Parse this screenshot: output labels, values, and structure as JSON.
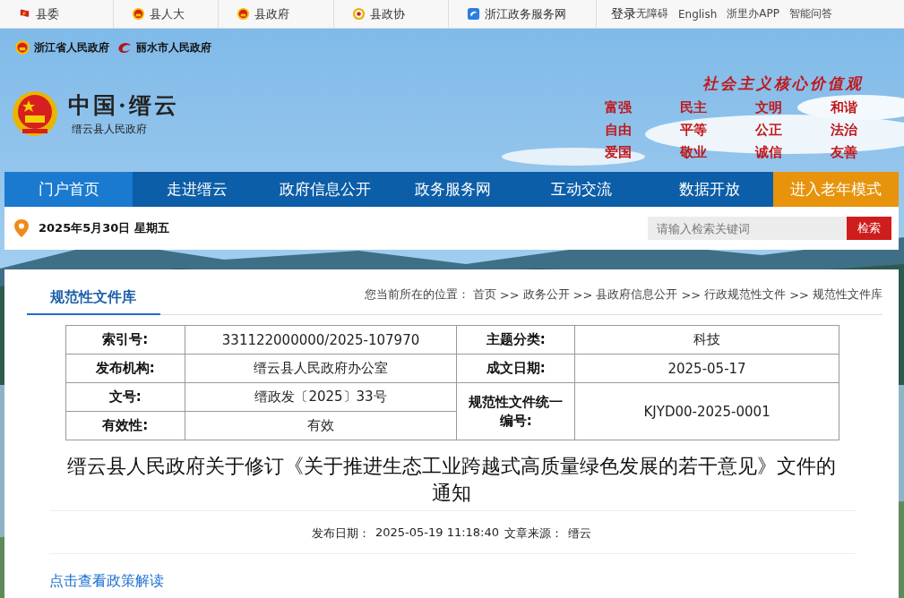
{
  "top_bar": {
    "links": [
      {
        "label": "县委",
        "kind": "party"
      },
      {
        "label": "县人大",
        "kind": "emblem"
      },
      {
        "label": "县政府",
        "kind": "emblem"
      },
      {
        "label": "县政协",
        "kind": "cppcc"
      },
      {
        "label": "浙江政务服务网",
        "kind": "service"
      }
    ],
    "login": "登录",
    "right_links": [
      "无障碍",
      "English",
      "浙里办APP",
      "智能问答"
    ]
  },
  "banner": {
    "parent_sites": [
      {
        "label": "浙江省人民政府",
        "kind": "emblem"
      },
      {
        "label": "丽水市人民政府",
        "kind": "city"
      }
    ],
    "site_title": "中国·缙云",
    "site_subtitle": "缙云县人民政府",
    "values_title": "社会主义核心价值观",
    "values": [
      "富强",
      "民主",
      "文明",
      "和谐",
      "自由",
      "平等",
      "公正",
      "法治",
      "爱国",
      "敬业",
      "诚信",
      "友善"
    ]
  },
  "nav": [
    {
      "label": "门户首页",
      "kind": "normal",
      "selected": true
    },
    {
      "label": "走进缙云",
      "kind": "normal",
      "selected": false
    },
    {
      "label": "政府信息公开",
      "kind": "normal",
      "selected": false
    },
    {
      "label": "政务服务网",
      "kind": "normal",
      "selected": false
    },
    {
      "label": "互动交流",
      "kind": "normal",
      "selected": false
    },
    {
      "label": "数据开放",
      "kind": "normal",
      "selected": false
    },
    {
      "label": "进入老年模式",
      "kind": "elder",
      "selected": false
    }
  ],
  "date_bar": {
    "date": "2025年5月30日 星期五",
    "search": {
      "placeholder": "请输入检索关键词",
      "button": "检索"
    }
  },
  "content": {
    "section_tab": "规范性文件库",
    "breadcrumb": {
      "prefix": "您当前所在的位置：",
      "items": [
        {
          "label": "首页",
          "separator": ">>"
        },
        {
          "label": "政务公开",
          "separator": ">>"
        },
        {
          "label": "县政府信息公开",
          "separator": ">>"
        },
        {
          "label": "行政规范性文件",
          "separator": ">>"
        },
        {
          "label": "规范性文件库"
        }
      ]
    },
    "info_table": {
      "left": [
        {
          "label": "索引号:",
          "value": "331122000000/2025-107970"
        },
        {
          "label": "发布机构:",
          "value": "缙云县人民政府办公室"
        },
        {
          "label": "文号:",
          "value": "缙政发〔2025〕33号"
        },
        {
          "label": "有效性:",
          "value": "有效"
        }
      ],
      "right": [
        {
          "label": "主题分类:",
          "value": "科技"
        },
        {
          "label": "成文日期:",
          "value": "2025-05-17"
        },
        {
          "label": "规范性文件统一编号:",
          "value": "KJYD00-2025-0001"
        }
      ]
    },
    "title": "缙云县人民政府关于修订《关于推进生态工业跨越式高质量绿色发展的若干意见》文件的通知",
    "meta": [
      {
        "label": "发布日期：",
        "value": "2025-05-19 11:18:40"
      },
      {
        "label": "文章来源：",
        "value": "缙云"
      }
    ],
    "interpretation_link": "点击查看政策解读"
  }
}
